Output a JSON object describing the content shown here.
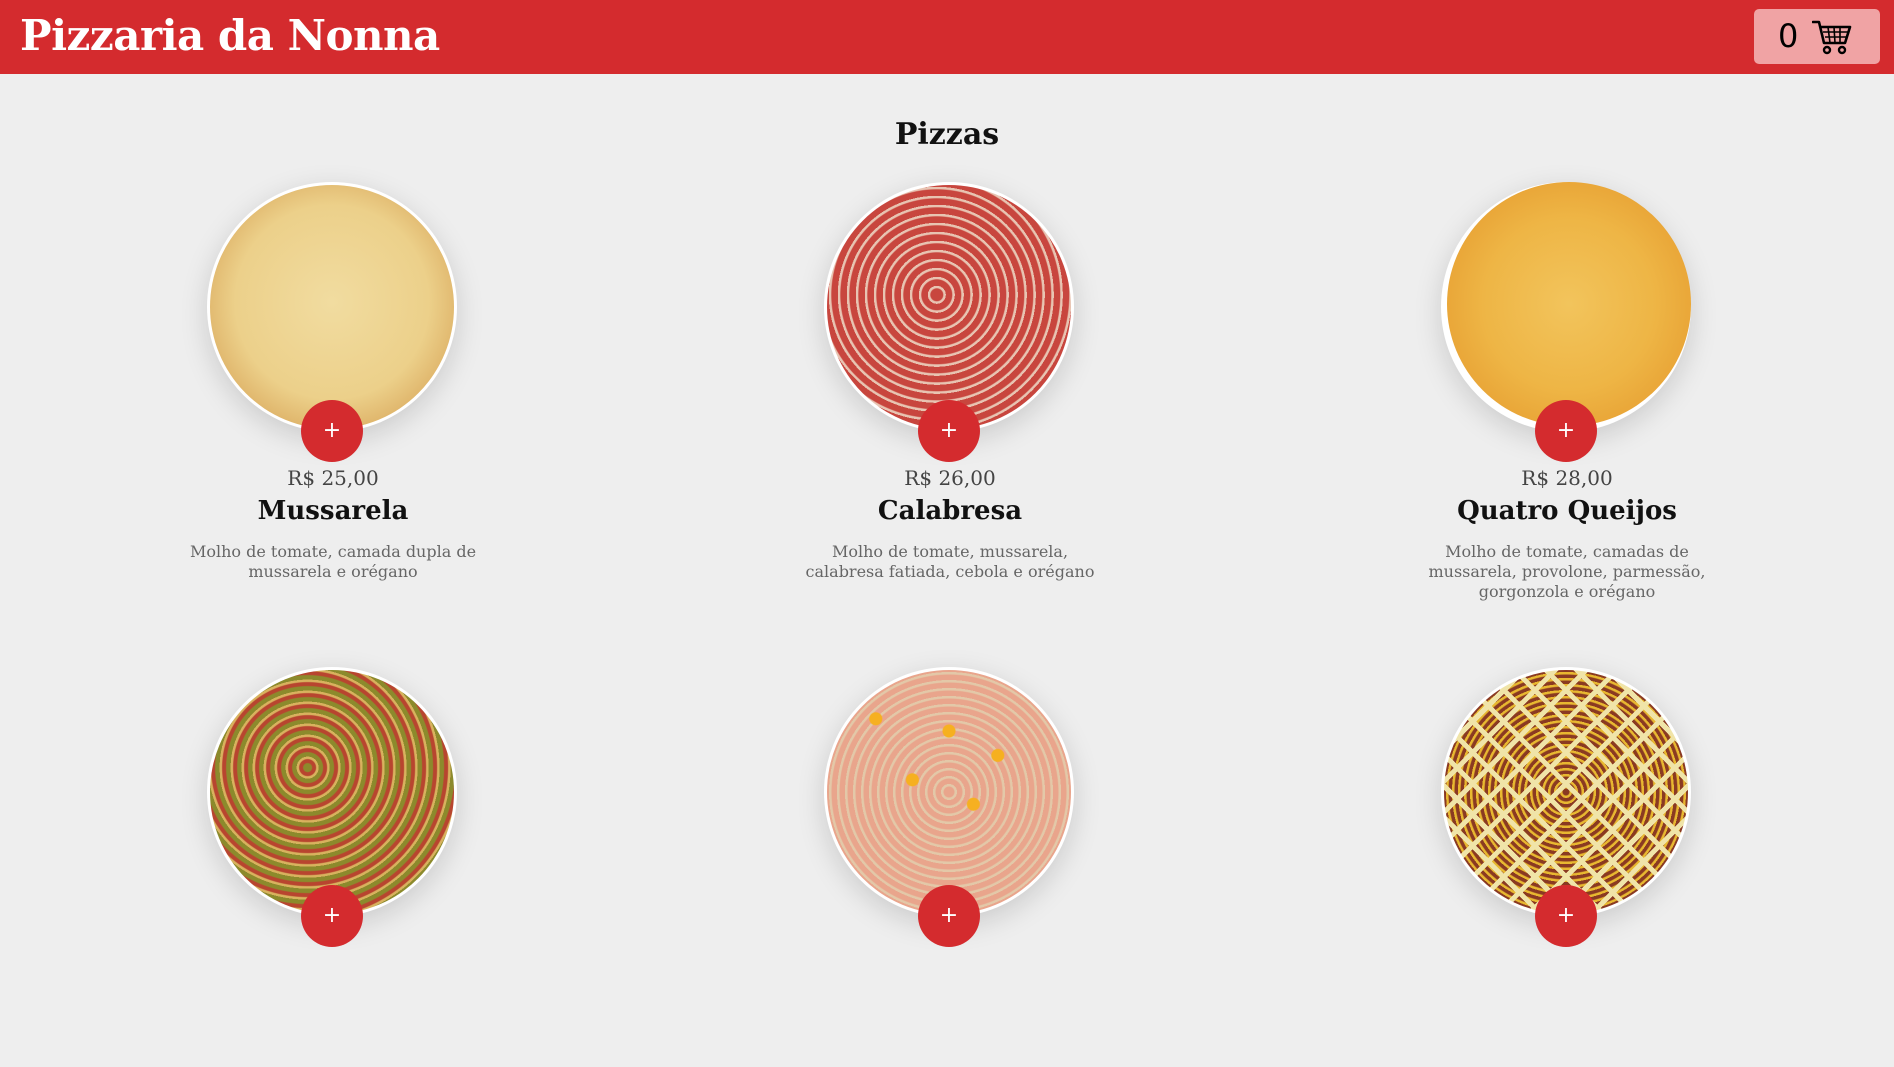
{
  "header": {
    "brand": "Pizzaria da Nonna",
    "cart_count": "0",
    "cart_icon": "cart-icon"
  },
  "section_title": "Pizzas",
  "pizzas": [
    {
      "name": "Mussarela",
      "price": "R$ 25,00",
      "description": "Molho de tomate, camada dupla de mussarela e orégano",
      "add_label": "+"
    },
    {
      "name": "Calabresa",
      "price": "R$ 26,00",
      "description": "Molho de tomate, mussarela, calabresa fatiada, cebola e orégano",
      "add_label": "+"
    },
    {
      "name": "Quatro Queijos",
      "price": "R$ 28,00",
      "description": "Molho de tomate, camadas de mussarela, provolone, parmessão, gorgonzola e orégano",
      "add_label": "+"
    },
    {
      "add_label": "+"
    },
    {
      "add_label": "+"
    },
    {
      "add_label": "+"
    }
  ],
  "colors": {
    "brand_red": "#d42b2e",
    "cart_bg": "#f0a3a4",
    "page_bg": "#eeeeee"
  }
}
